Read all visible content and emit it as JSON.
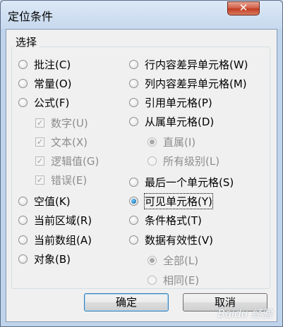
{
  "window": {
    "title": "定位条件",
    "close_symbol": "✕"
  },
  "group": {
    "label": "选择"
  },
  "left_options": [
    {
      "label": "批注(C)",
      "checked": false,
      "disabled": false
    },
    {
      "label": "常量(O)",
      "checked": false,
      "disabled": false
    },
    {
      "label": "公式(F)",
      "checked": false,
      "disabled": false
    },
    {
      "label": "数字(U)",
      "checked": true,
      "disabled": true
    },
    {
      "label": "文本(X)",
      "checked": true,
      "disabled": true
    },
    {
      "label": "逻辑值(G)",
      "checked": true,
      "disabled": true
    },
    {
      "label": "错误(E)",
      "checked": true,
      "disabled": true
    },
    {
      "label": "空值(K)",
      "checked": false,
      "disabled": false
    },
    {
      "label": "当前区域(R)",
      "checked": false,
      "disabled": false
    },
    {
      "label": "当前数组(A)",
      "checked": false,
      "disabled": false
    },
    {
      "label": "对象(B)",
      "checked": false,
      "disabled": false
    }
  ],
  "right_options": [
    {
      "label": "行内容差异单元格(W)",
      "checked": false,
      "disabled": false
    },
    {
      "label": "列内容差异单元格(M)",
      "checked": false,
      "disabled": false
    },
    {
      "label": "引用单元格(P)",
      "checked": false,
      "disabled": false
    },
    {
      "label": "从属单元格(D)",
      "checked": false,
      "disabled": false
    },
    {
      "label": "直属(I)",
      "checked": true,
      "disabled": true
    },
    {
      "label": "所有级别(L)",
      "checked": false,
      "disabled": true
    },
    {
      "label": "最后一个单元格(S)",
      "checked": false,
      "disabled": false
    },
    {
      "label": "可见单元格(Y)",
      "checked": true,
      "disabled": false
    },
    {
      "label": "条件格式(T)",
      "checked": false,
      "disabled": false
    },
    {
      "label": "数据有效性(V)",
      "checked": false,
      "disabled": false
    },
    {
      "label": "全部(L)",
      "checked": true,
      "disabled": true
    },
    {
      "label": "相同(E)",
      "checked": false,
      "disabled": true
    }
  ],
  "buttons": {
    "ok": "确定",
    "cancel": "取消"
  },
  "watermark": "Baidu 经验"
}
